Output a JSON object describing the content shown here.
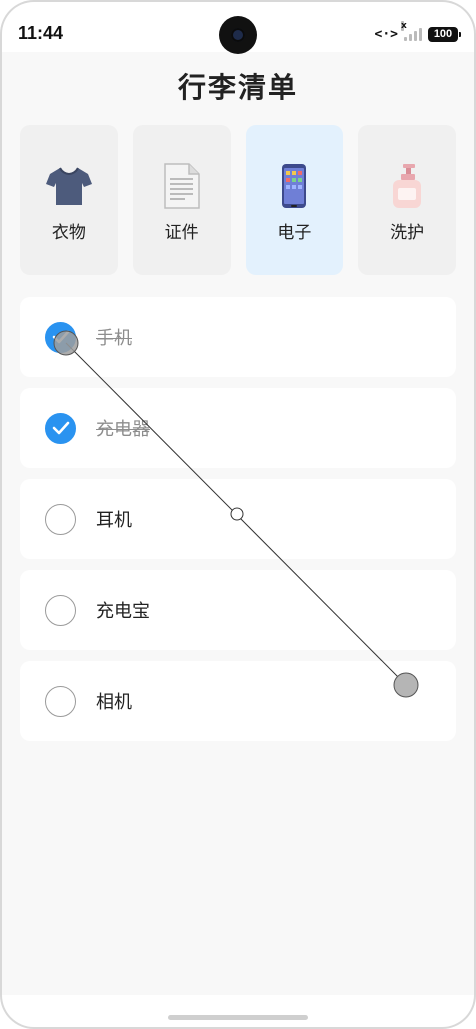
{
  "status_bar": {
    "time": "11:44",
    "code_icon": "<·>",
    "signal_x": "x",
    "battery": "100"
  },
  "page": {
    "title": "行李清单"
  },
  "categories": [
    {
      "label": "衣物",
      "icon": "tshirt-icon",
      "active": false
    },
    {
      "label": "证件",
      "icon": "document-icon",
      "active": false
    },
    {
      "label": "电子",
      "icon": "phone-icon",
      "active": true
    },
    {
      "label": "洗护",
      "icon": "lotion-bottle-icon",
      "active": false
    }
  ],
  "items": [
    {
      "label": "手机",
      "checked": true
    },
    {
      "label": "充电器",
      "checked": true
    },
    {
      "label": "耳机",
      "checked": false
    },
    {
      "label": "充电宝",
      "checked": false
    },
    {
      "label": "相机",
      "checked": false
    }
  ],
  "colors": {
    "accent": "#2a93f0",
    "active_category_bg": "#e3f1fd",
    "background": "#f8f8f8"
  }
}
